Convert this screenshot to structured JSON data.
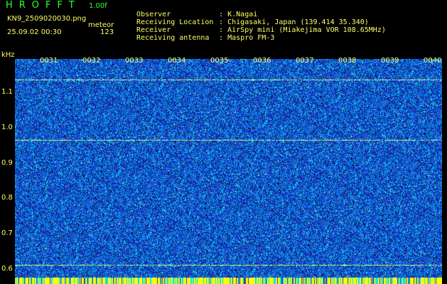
{
  "header": {
    "logo": "HROFFT",
    "version": "1.00f",
    "filename": "KN9_2509020030.png",
    "mode": "meteor",
    "timestamp": "25.09.02 00:30",
    "count": "123"
  },
  "info": [
    {
      "key": "Observer",
      "sep": ":",
      "value": "K.Nagai"
    },
    {
      "key": "Receiving Location",
      "sep": ":",
      "value": "Chigasaki, Japan (139.414 35.340)"
    },
    {
      "key": "Receiver",
      "sep": ":",
      "value": "AirSpy mini (Miakejima VOR 108.65MHz)"
    },
    {
      "key": "Receiving antenna",
      "sep": ":",
      "value": "Maspro FM-3"
    }
  ],
  "spectrogram": {
    "y_unit": "kHz",
    "y_ticks": [
      "1.1",
      "1.0",
      "0.9",
      "0.8",
      "0.7",
      "0.6"
    ],
    "x_ticks": [
      "0031",
      "0032",
      "0033",
      "0034",
      "0035",
      "0036",
      "0037",
      "0038",
      "0039",
      "0040"
    ],
    "y_range": [
      0.58,
      1.16
    ],
    "signal_lines_khz": [
      1.105,
      0.945,
      0.612
    ],
    "colors": {
      "background": "#1a2aa0",
      "noise": "#00c8ff",
      "signal": "#e0ff80",
      "bottom_band": "#ffff00"
    }
  }
}
